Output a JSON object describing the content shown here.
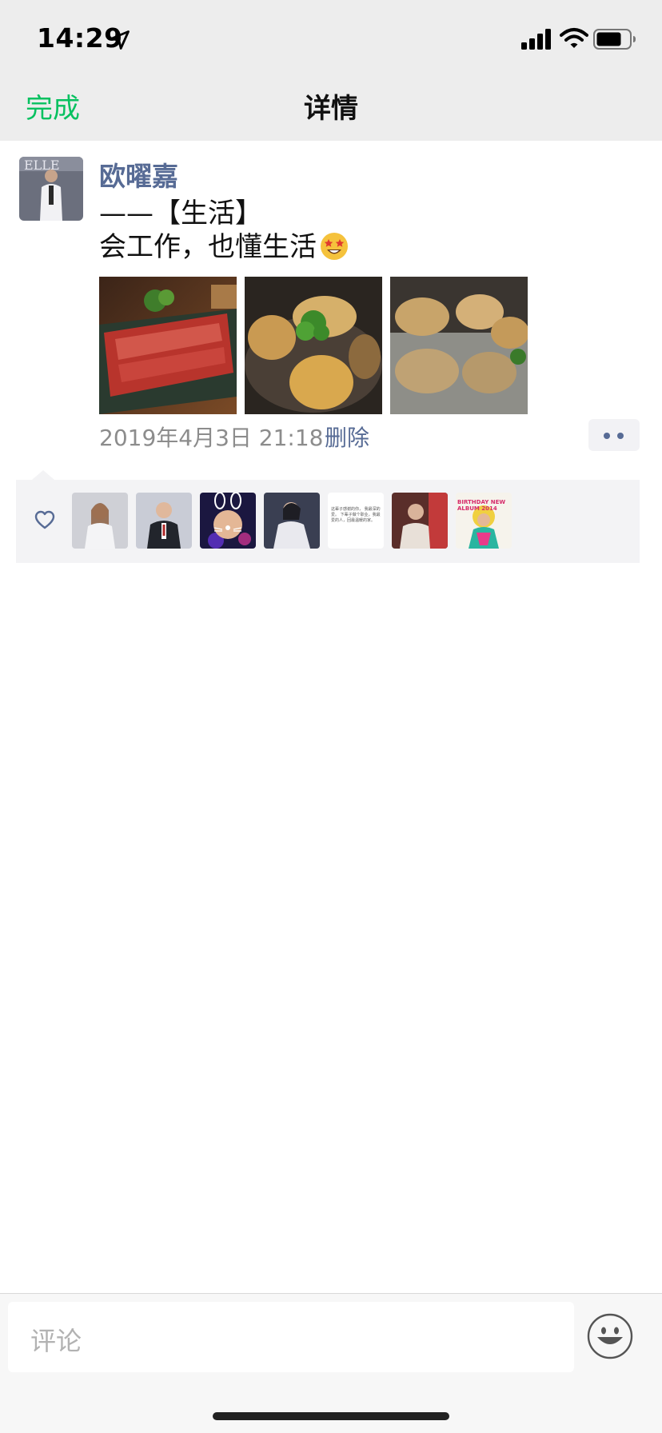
{
  "status_bar": {
    "time": "14:29",
    "icons": [
      "location-arrow-icon",
      "signal-icon",
      "wifi-icon",
      "battery-icon"
    ]
  },
  "nav": {
    "left_label": "完成",
    "title": "详情"
  },
  "post": {
    "author": "欧曜嘉",
    "content_lines": [
      "——【生活】",
      "会工作，也懂生活"
    ],
    "content_emoji": "star-struck-emoji",
    "photos": [
      "raw-beef-slices",
      "abalone-dish",
      "grilled-oysters"
    ],
    "timestamp": "2019年4月3日 21:18",
    "delete_label": "删除"
  },
  "likes": {
    "icon": "heart-icon",
    "avatars": [
      "liker-1",
      "liker-2",
      "liker-3",
      "liker-4",
      "liker-5",
      "liker-6",
      "liker-7"
    ],
    "liker5_text": "这辈子感谢的你， 我最深的爱。 下辈子做个职业，我最爱的人，回最温暖的家。",
    "liker7_text": "BIRTHDAY NEW ALBUM 2014"
  },
  "comment": {
    "placeholder": "评论",
    "emoji_icon": "smiley-icon"
  },
  "colors": {
    "accent": "#07c160",
    "link": "#576b95",
    "bar_bg": "#ededed"
  }
}
